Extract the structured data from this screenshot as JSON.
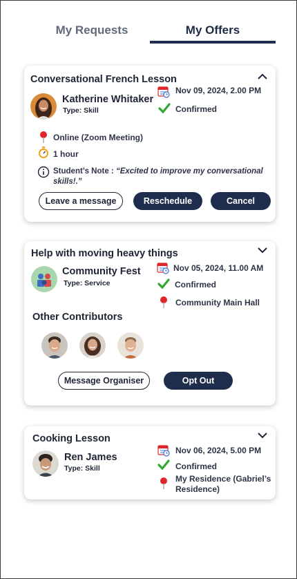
{
  "tabs": {
    "requests": "My Requests",
    "offers": "My Offers",
    "active": "offers"
  },
  "cards": [
    {
      "title": "Conversational French Lesson",
      "expanded": true,
      "person": {
        "name": "Katherine Whitaker",
        "type": "Type: Skill"
      },
      "datetime": "Nov 09, 2024, 2.00 PM",
      "status": "Confirmed",
      "location": "Online (Zoom Meeting)",
      "duration": "1 hour",
      "note_label": "Student’s Note : ",
      "note_line1": "“Excited to improve my conversational",
      "note_line2": "skills!.”",
      "buttons": {
        "message": "Leave a message",
        "reschedule": "Reschedule",
        "cancel": "Cancel"
      }
    },
    {
      "title": "Help with moving heavy things",
      "expanded": false,
      "person": {
        "name": "Community Fest",
        "type": "Type: Service"
      },
      "datetime": "Nov 05, 2024, 11.00 AM",
      "status": "Confirmed",
      "location": "Community Main Hall",
      "contributors_label": "Other Contributors",
      "buttons": {
        "message": "Message Organiser",
        "opt_out": "Opt Out"
      }
    },
    {
      "title": "Cooking Lesson",
      "expanded": false,
      "person": {
        "name": "Ren James",
        "type": "Type: Skill"
      },
      "datetime": "Nov 06, 2024, 5.00 PM",
      "status": "Confirmed",
      "location_line1": "My Residence (Gabriel’s",
      "location_line2": "Residence)"
    }
  ],
  "colors": {
    "navy": "#1f2d4d",
    "confirmed_green": "#2ea82e",
    "pin_red": "#e0262b",
    "calendar_blue": "#3d6fd0"
  }
}
